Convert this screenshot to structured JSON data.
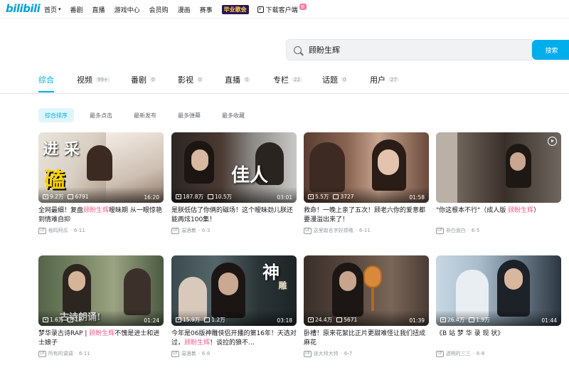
{
  "header": {
    "logo": "bilibili",
    "nav": [
      {
        "label": "首页",
        "dropdown": true
      },
      {
        "label": "番剧"
      },
      {
        "label": "直播"
      },
      {
        "label": "游戏中心"
      },
      {
        "label": "会员购"
      },
      {
        "label": "漫画"
      },
      {
        "label": "赛事"
      }
    ],
    "event_label": "毕业歌会",
    "download_label": "下载客户端",
    "download_badge": "新"
  },
  "search": {
    "query": "顾盼生辉",
    "button_label": "搜索"
  },
  "tabs": [
    {
      "label": "综合",
      "count": ""
    },
    {
      "label": "视频",
      "count": "99+"
    },
    {
      "label": "番剧",
      "count": "0"
    },
    {
      "label": "影视",
      "count": "0"
    },
    {
      "label": "直播",
      "count": "0"
    },
    {
      "label": "专栏",
      "count": "22"
    },
    {
      "label": "话题",
      "count": "0"
    },
    {
      "label": "用户",
      "count": "27"
    }
  ],
  "active_tab": "综合",
  "filters": [
    "综合排序",
    "最多点击",
    "最新发布",
    "最多弹幕",
    "最多收藏"
  ],
  "active_filter": "综合排序",
  "videos": [
    {
      "views": "9.2万",
      "danmaku": "6791",
      "duration": "16:20",
      "title_pre": "全网最细！复盘",
      "title_hl": "顾盼生辉",
      "title_post": "暧昧期 从一眼惊艳到情难自抑",
      "author": "格鸣阿瓜",
      "date": "6-11",
      "overlay": "进 采 磕"
    },
    {
      "views": "187.8万",
      "danmaku": "10.5万",
      "duration": "03:01",
      "title_pre": "是朕低估了你俩的磁场！这个暧昧劲儿朕还能再炫100集！",
      "title_hl": "",
      "title_post": "",
      "author": "温酒着",
      "date": "6-3",
      "overlay": "佳 人"
    },
    {
      "views": "5.5万",
      "danmaku": "3727",
      "duration": "01:58",
      "title_pre": "救命！一晚上亲了五次！顾老六你的爱意都要漫溢出来了！",
      "title_hl": "",
      "title_post": "",
      "author": "这里取名字好烦哦",
      "date": "6-11",
      "overlay": ""
    },
    {
      "views": "",
      "danmaku": "",
      "duration": "",
      "title_pre": "\"你这根本不行\"（成人版 ",
      "title_hl": "顾盼生辉",
      "title_post": "）",
      "author": "非白道白",
      "date": "6-5",
      "overlay": ""
    },
    {
      "views": "1.6万",
      "danmaku": "18",
      "duration": "01:24",
      "title_pre": "梦华录古诗RAP | ",
      "title_hl": "顾盼生辉",
      "title_post": "不愧是进士和进士娘子",
      "author": "所有的调调",
      "date": "6-11",
      "overlay": "古诗朗诵!"
    },
    {
      "views": "15.9万",
      "danmaku": "1.2万",
      "duration": "03:18",
      "title_pre": "今年是06版神雕侠侣开播的第16年！天选对过，",
      "title_hl": "顾盼生辉",
      "title_post": "！谈拉的狼不…",
      "author": "温酒着",
      "date": "6-8",
      "overlay": "神 雕"
    },
    {
      "views": "24.4万",
      "danmaku": "5671",
      "duration": "01:39",
      "title_pre": "卧槽！原来花絮比正片更甜难怪让我们扭成麻花",
      "title_hl": "",
      "title_post": "",
      "author": "张大帅大帅",
      "date": "6-7",
      "overlay": ""
    },
    {
      "views": "26.4万",
      "danmaku": "1.9万",
      "duration": "01:44",
      "title_pre": "《B 站 梦 华 录 现 状》",
      "title_hl": "",
      "title_post": "",
      "author": "透明的三三",
      "date": "6-8",
      "overlay": ""
    }
  ],
  "colors": {
    "brand": "#00a1d6",
    "accent": "#00aeec",
    "highlight": "#f25d8e"
  }
}
